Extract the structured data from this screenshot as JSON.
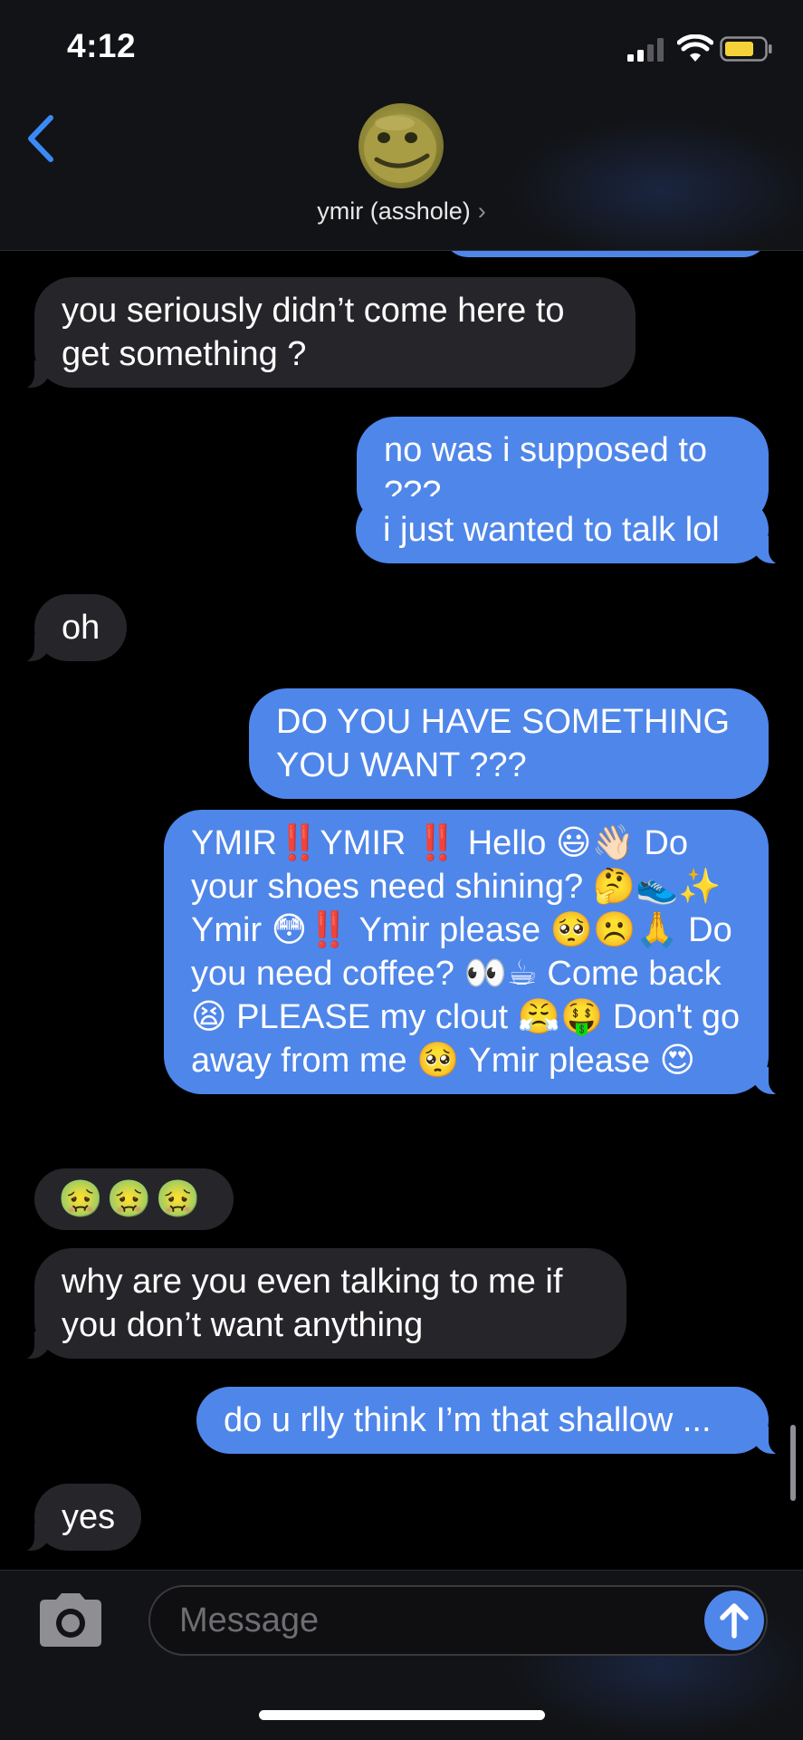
{
  "status_bar": {
    "time": "4:12",
    "signal_icon": "cellular-signal-icon",
    "wifi_icon": "wifi-icon",
    "battery_icon": "battery-icon",
    "battery_color": "#f5d23a"
  },
  "header": {
    "back_icon": "chevron-left-icon",
    "avatar": "contact-photo",
    "contact_name": "ymir (asshole)",
    "name_chevron": "›"
  },
  "messages": [
    {
      "from": "them",
      "text": "you seriously didn’t come here to get something ?"
    },
    {
      "from": "me",
      "text": "no was i supposed to ???"
    },
    {
      "from": "me",
      "text": "i just wanted to talk lol"
    },
    {
      "from": "them",
      "text": "oh"
    },
    {
      "from": "me",
      "text": "DO YOU HAVE SOMETHING YOU WANT ???"
    },
    {
      "from": "me",
      "text": "YMIR‼️YMIR ‼️ Hello 😃👋🏻 Do your shoes need shining? 🤔👟✨ Ymir 😳‼️ Ymir please 🥺☹️🙏 Do you need coffee? 👀☕ Come back 😫 PLEASE my clout 😤🤑 Don't go away from me 🥺 Ymir please 😍"
    },
    {
      "from": "them",
      "text": "🤢🤢🤢"
    },
    {
      "from": "them",
      "text": "why are you even talking to me if you don’t want anything"
    },
    {
      "from": "me",
      "text": "do u rlly think I’m that shallow ..."
    },
    {
      "from": "them",
      "text": "yes"
    }
  ],
  "input_bar": {
    "camera_icon": "camera-icon",
    "placeholder": "Message",
    "send_icon": "arrow-up-icon"
  },
  "colors": {
    "sent_bubble": "#4f86ea",
    "received_bubble": "#26262a",
    "background": "#000000",
    "bar_background": "#121316"
  }
}
